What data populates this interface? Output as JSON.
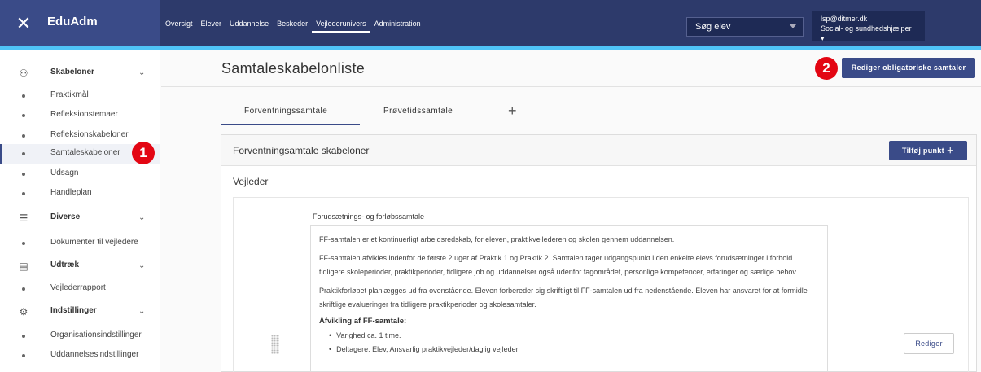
{
  "app": {
    "brand": "EduAdm",
    "close_icon": "close-icon"
  },
  "nav": {
    "items": [
      "Oversigt",
      "Elever",
      "Uddannelse",
      "Beskeder",
      "Vejlederunivers",
      "Administration"
    ],
    "active": "Vejlederunivers"
  },
  "search": {
    "label": "Søg elev"
  },
  "user": {
    "email": "lsp@ditmer.dk",
    "role": "Social- og sundhedshjælper ▾"
  },
  "sidebar": {
    "groups": [
      {
        "label": "Skabeloner",
        "icon": "hierarchy-icon",
        "items": [
          "Praktikmål",
          "Refleksionstemaer",
          "Refleksionskabeloner",
          "Samtaleskabeloner",
          "Udsagn",
          "Handleplan"
        ]
      },
      {
        "label": "Diverse",
        "icon": "list-icon",
        "items": [
          "Dokumenter til vejledere"
        ]
      },
      {
        "label": "Udtræk",
        "icon": "report-icon",
        "items": [
          "Vejlederrapport"
        ]
      },
      {
        "label": "Indstillinger",
        "icon": "settings-icon",
        "items": [
          "Organisationsindstillinger",
          "Uddannelsesindstillinger"
        ]
      }
    ],
    "active_item": "Samtaleskabeloner"
  },
  "badges": {
    "one": "1",
    "two": "2"
  },
  "page": {
    "title": "Samtaleskabelonliste",
    "edit_mandatory_button": "Rediger obligatoriske samtaler"
  },
  "tabs": {
    "items": [
      "Forventningssamtale",
      "Prøvetidssamtale"
    ],
    "add_label": "+"
  },
  "card": {
    "title": "Forventningsamtale skabeloner",
    "add_point_button": "Tilføj punkt ＋",
    "section": "Vejleder",
    "item": {
      "title": "Forudsætnings- og forløbssamtale",
      "paragraphs": [
        "FF-samtalen er et kontinuerligt arbejdsredskab, for eleven, praktikvejlederen og skolen gennem uddannelsen.",
        "FF-samtalen afvikles indenfor de første 2 uger af Praktik 1 og Praktik 2. Samtalen tager udgangspunkt i den enkelte elevs forudsætninger i forhold tidligere skoleperioder, praktikperioder, tidligere job og uddannelser også udenfor fagområdet, personlige kompetencer, erfaringer og særlige behov.",
        "Praktikforløbet planlægges ud fra ovenstående. Eleven forbereder sig skriftligt til FF-samtalen ud fra nedenstående. Eleven har ansvaret for at formidle skriftlige evalueringer fra tidligere praktikperioder og skolesamtaler."
      ],
      "subheading": "Afvikling af FF-samtale:",
      "bullets": [
        "Varighed ca. 1 time.",
        "Deltagere: Elev, Ansvarlig praktikvejleder/daglig vejleder"
      ],
      "edit_button": "Rediger"
    }
  }
}
